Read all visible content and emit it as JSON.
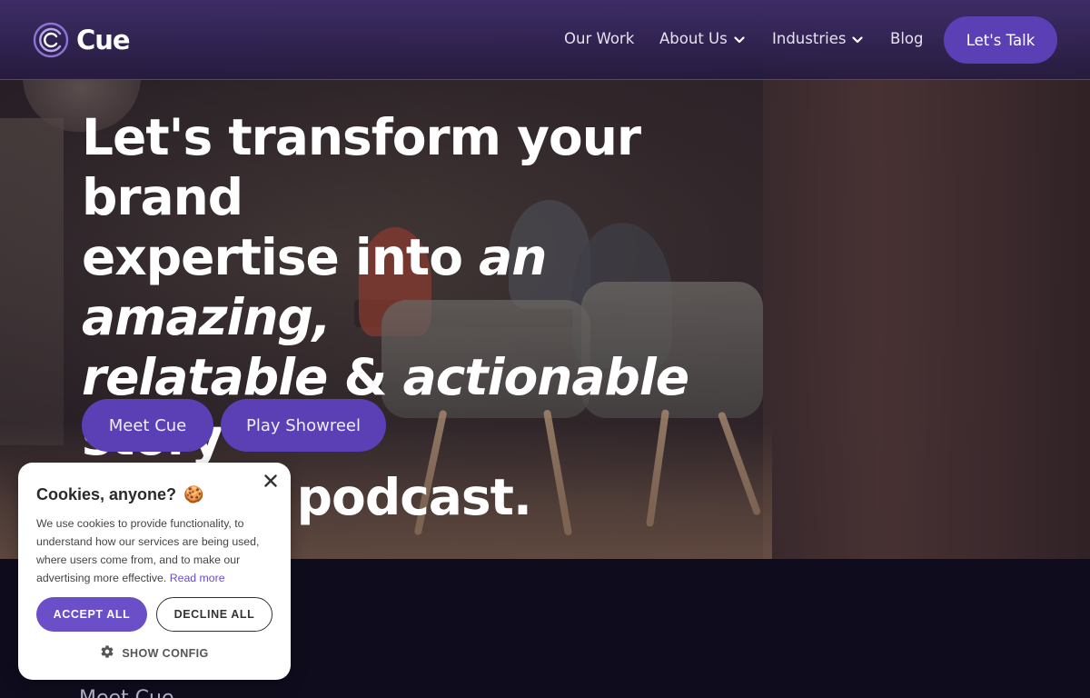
{
  "brand": {
    "name": "Cue",
    "accent": "#5b3fb5",
    "header_bg": "#3d2c66"
  },
  "nav": {
    "items": [
      {
        "label": "Our Work",
        "has_dropdown": false
      },
      {
        "label": "About Us",
        "has_dropdown": true
      },
      {
        "label": "Industries",
        "has_dropdown": true
      },
      {
        "label": "Blog",
        "has_dropdown": false
      }
    ],
    "cta_label": "Let's Talk"
  },
  "hero": {
    "headline_parts": [
      {
        "text": "Let's transform your brand",
        "italic": false
      },
      {
        "text": "expertise into ",
        "italic": false
      },
      {
        "text": "an amazing,",
        "italic": true
      },
      {
        "text": "relatable",
        "italic": true
      },
      {
        "text": " & ",
        "italic": false
      },
      {
        "text": "actionable",
        "italic": true
      },
      {
        "text": " story",
        "italic": false
      },
      {
        "text": "using a podcast.",
        "italic": false
      }
    ],
    "buttons": {
      "meet": "Meet Cue",
      "showreel": "Play Showreel"
    }
  },
  "below_fold": {
    "peek_text": "Meet Cue"
  },
  "cookie": {
    "title": "Cookies, anyone?",
    "emoji": "🍪",
    "body": "We use cookies to provide functionality, to understand how our services are being used, where users come from, and to make our advertising more effective. ",
    "link": "Read more",
    "accept": "ACCEPT ALL",
    "decline": "DECLINE ALL",
    "config": "SHOW CONFIG",
    "icons": {
      "close": "close-icon",
      "config": "gear-icon"
    }
  }
}
